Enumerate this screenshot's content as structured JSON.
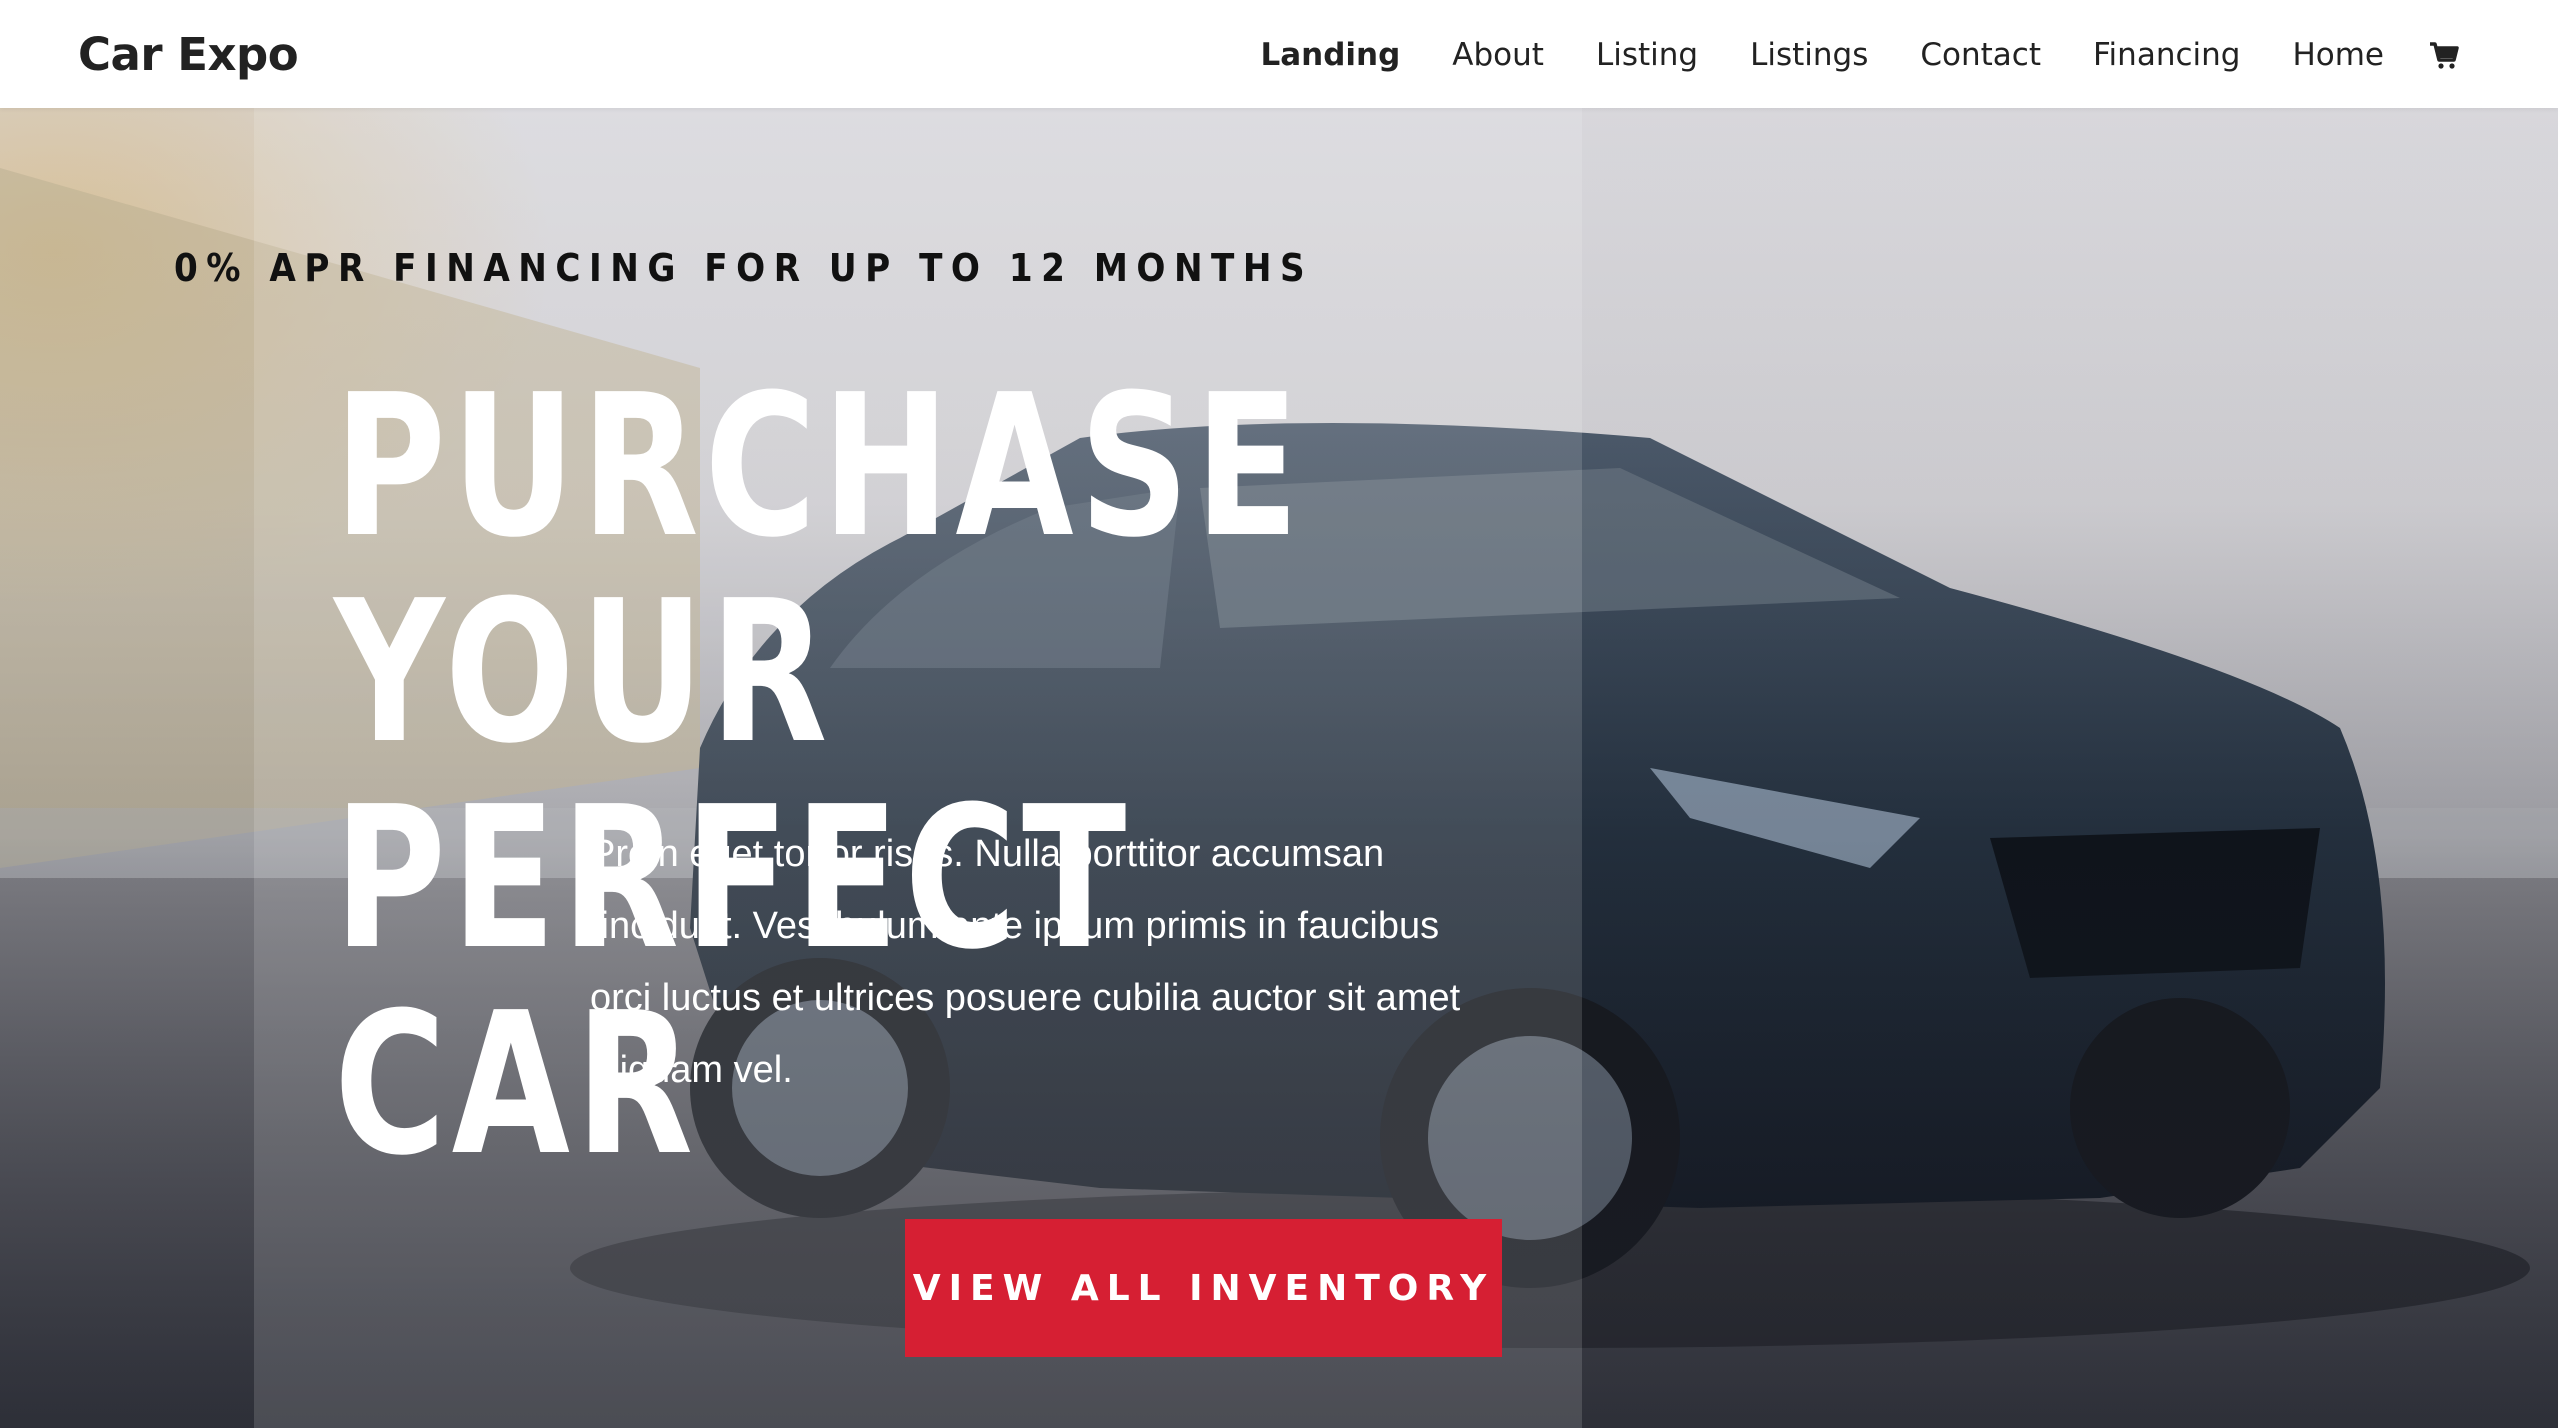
{
  "header": {
    "logo": "Car Expo",
    "nav": [
      {
        "label": "Landing",
        "active": true
      },
      {
        "label": "About"
      },
      {
        "label": "Listing"
      },
      {
        "label": "Listings"
      },
      {
        "label": "Contact"
      },
      {
        "label": "Financing"
      },
      {
        "label": "Home"
      }
    ],
    "cart_icon": "shopping-cart-icon"
  },
  "hero": {
    "eyebrow": "0% APR FINANCING FOR UP TO 12 MONTHS",
    "headline_line1": "PURCHASE YOUR",
    "headline_line2": "PERFECT CAR",
    "body_line1": "Proin eget tortor risus. Nulla porttitor accumsan",
    "body_line2": "tincidunt. Vestibulum ante ipsum primis in faucibus",
    "body_line3": "orci luctus et ultrices posuere cubilia auctor sit amet",
    "body_line4": "aliquam vel.",
    "cta_label": "VIEW ALL INVENTORY",
    "background_image": "dark-blue-suv-photo"
  },
  "colors": {
    "accent": "#d61f33",
    "text_dark": "#222222",
    "hero_text": "#ffffff"
  }
}
